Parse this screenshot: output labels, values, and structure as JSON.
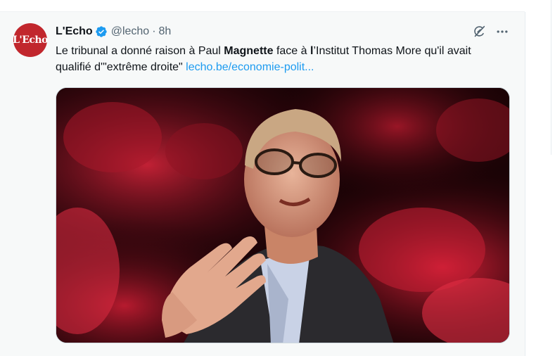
{
  "tweet": {
    "avatar_text": "L'Echo",
    "display_name": "L'Echo",
    "handle": "@lecho",
    "separator": "·",
    "time": "8h",
    "text_part1": "Le tribunal a donné raison à Paul ",
    "text_bold1": "Magnette",
    "text_part2": " face à ",
    "text_bold2": "l",
    "text_part3": "’Institut Thomas More qu'il avait qualifié d'\"extrême droite\" ",
    "link_text": "lecho.be/economie-polit...",
    "icons": {
      "verified": "verified-badge-icon",
      "grok": "grok-icon",
      "more": "more-icon"
    },
    "media_description": "photo"
  },
  "colors": {
    "accent": "#1d9bf0",
    "avatar_bg": "#c1272d",
    "text": "#0f1419",
    "muted": "#536471",
    "tweet_bg": "#f7f9f9"
  }
}
